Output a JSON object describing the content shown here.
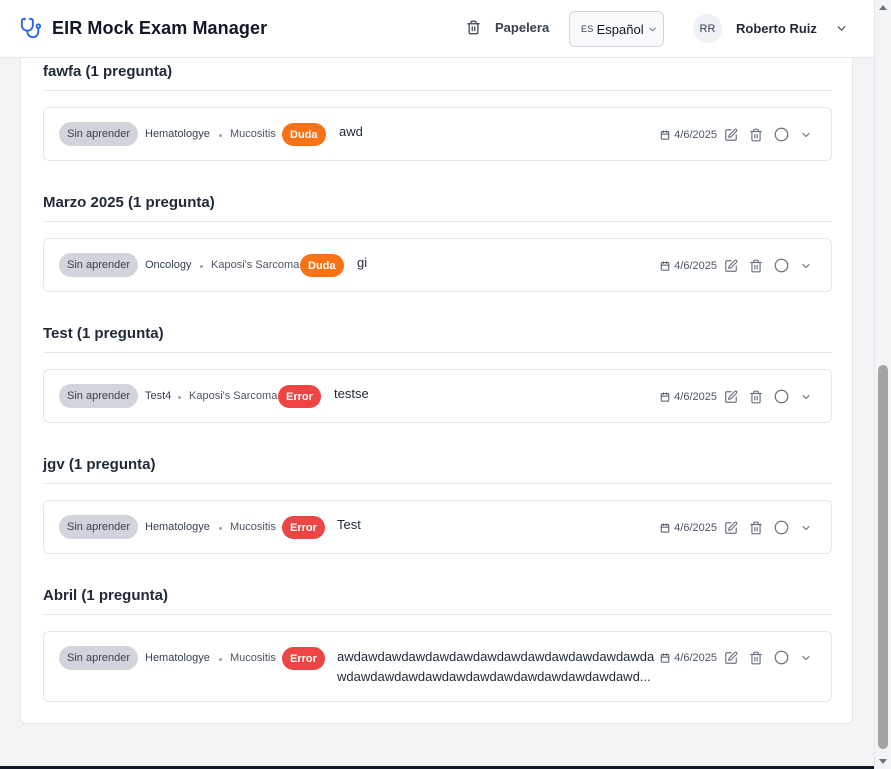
{
  "header": {
    "app_title": "EIR Mock Exam Manager",
    "brand_icon": "stethoscope-icon",
    "trash_label": "Papelera",
    "language": {
      "code": "ES",
      "selected": "Español"
    },
    "user": {
      "initials": "RR",
      "name": "Roberto Ruiz"
    }
  },
  "colors": {
    "accent": "#2563eb",
    "duda": "#f97316",
    "error": "#ef4444",
    "status_pill": "#d1d5db"
  },
  "groups": [
    {
      "title": "fawfa (1 pregunta)",
      "items": [
        {
          "status": "Sin aprender",
          "subject": "Hematologye",
          "topic": "Mucositis",
          "tag": "Duda",
          "tag_type": "duda",
          "text": "awd",
          "text_line2": "",
          "date": "4/6/2025"
        }
      ]
    },
    {
      "title": "Marzo 2025 (1 pregunta)",
      "items": [
        {
          "status": "Sin aprender",
          "subject": "Oncology",
          "topic": "Kaposi's Sarcoma",
          "tag": "Duda",
          "tag_type": "duda",
          "text": "gi",
          "text_line2": "",
          "date": "4/6/2025"
        }
      ]
    },
    {
      "title": "Test (1 pregunta)",
      "items": [
        {
          "status": "Sin aprender",
          "subject": "Test4",
          "topic": "Kaposi's Sarcoma",
          "tag": "Error",
          "tag_type": "error",
          "text": "testse",
          "text_line2": "",
          "date": "4/6/2025"
        }
      ]
    },
    {
      "title": "jgv (1 pregunta)",
      "items": [
        {
          "status": "Sin aprender",
          "subject": "Hematologye",
          "topic": "Mucositis",
          "tag": "Error",
          "tag_type": "error",
          "text": "Test",
          "text_line2": "",
          "date": "4/6/2025"
        }
      ]
    },
    {
      "title": "Abril (1 pregunta)",
      "items": [
        {
          "status": "Sin aprender",
          "subject": "Hematologye",
          "topic": "Mucositis",
          "tag": "Error",
          "tag_type": "error",
          "text": "awdawdawdawdawdawdawdawdawdawdawdawdawda",
          "text_line2": "wdawdawdawdawdawdawdawdawdawdawdawdawd...",
          "date": "4/6/2025"
        }
      ]
    }
  ]
}
